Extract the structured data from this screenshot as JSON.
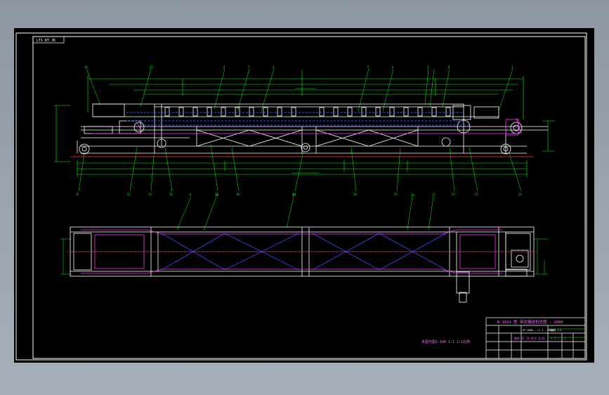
{
  "window": {
    "background": "#8e98a4",
    "canvas_background": "#000000"
  },
  "sheet": {
    "corner_label": "LT1 KT JK",
    "note": "本图与图1:100 1:1 1:1比例",
    "colors": {
      "frame": "#ffffff",
      "part": "#ffffff",
      "dimension": "#00ff00",
      "centerline": "#ff3333",
      "hidden": "#3333ff",
      "accent": "#ff33ff",
      "leader": "#00ff66",
      "note": "#ff66ff"
    }
  },
  "title_block": {
    "title": "B 1011 型  带式输送机总图 - 2000",
    "row2_left": "DT 1000 - LT 1 - 0000",
    "row2_right": "比例 1:1",
    "row3_left": "图纸 号 74 序号 0.01",
    "row3_right": "1 2 1 : 1"
  }
}
